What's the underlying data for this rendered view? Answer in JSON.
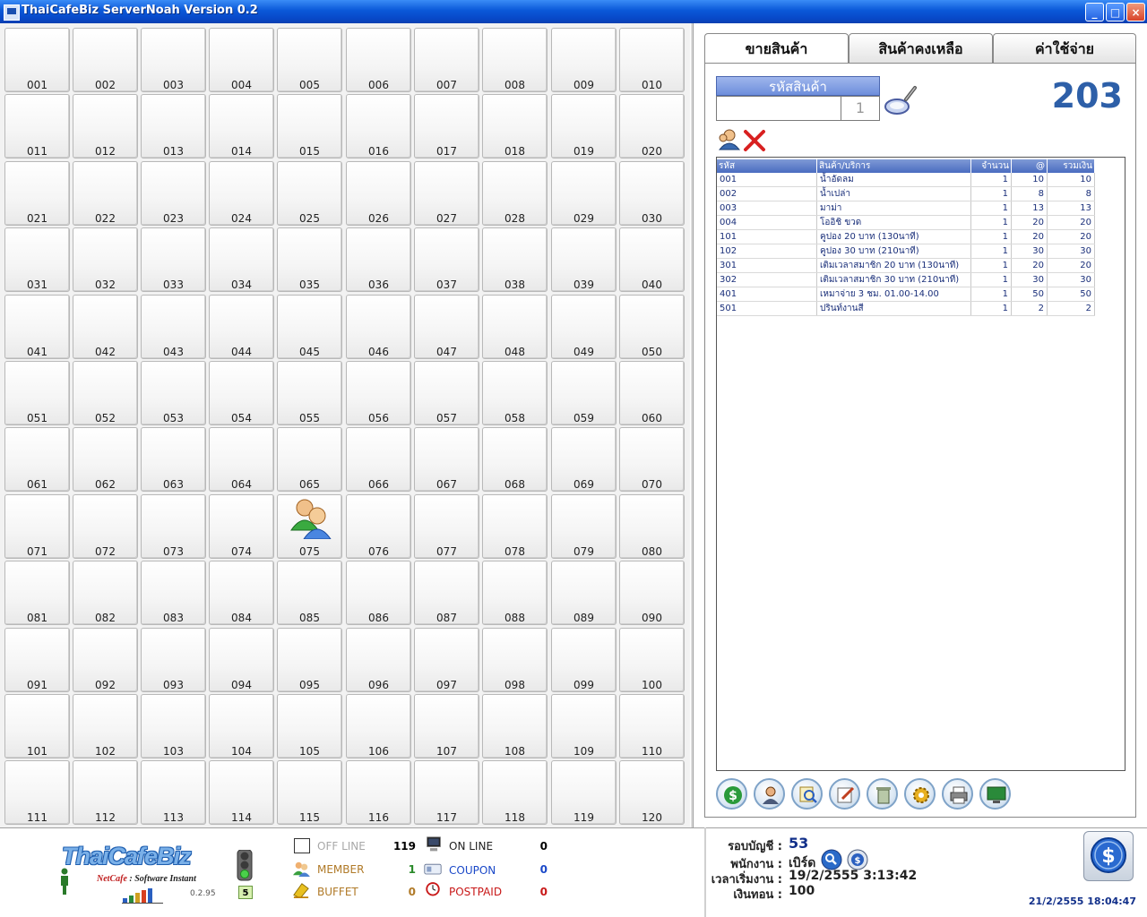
{
  "window": {
    "title": "ThaiCafeBiz ServerNoah Version 0.2",
    "minimize": "_",
    "maximize": "□",
    "close": "×"
  },
  "grid": {
    "occupied_station": "075",
    "stations": [
      "001",
      "002",
      "003",
      "004",
      "005",
      "006",
      "007",
      "008",
      "009",
      "010",
      "011",
      "012",
      "013",
      "014",
      "015",
      "016",
      "017",
      "018",
      "019",
      "020",
      "021",
      "022",
      "023",
      "024",
      "025",
      "026",
      "027",
      "028",
      "029",
      "030",
      "031",
      "032",
      "033",
      "034",
      "035",
      "036",
      "037",
      "038",
      "039",
      "040",
      "041",
      "042",
      "043",
      "044",
      "045",
      "046",
      "047",
      "048",
      "049",
      "050",
      "051",
      "052",
      "053",
      "054",
      "055",
      "056",
      "057",
      "058",
      "059",
      "060",
      "061",
      "062",
      "063",
      "064",
      "065",
      "066",
      "067",
      "068",
      "069",
      "070",
      "071",
      "072",
      "073",
      "074",
      "075",
      "076",
      "077",
      "078",
      "079",
      "080",
      "081",
      "082",
      "083",
      "084",
      "085",
      "086",
      "087",
      "088",
      "089",
      "090",
      "091",
      "092",
      "093",
      "094",
      "095",
      "096",
      "097",
      "098",
      "099",
      "100",
      "101",
      "102",
      "103",
      "104",
      "105",
      "106",
      "107",
      "108",
      "109",
      "110",
      "111",
      "112",
      "113",
      "114",
      "115",
      "116",
      "117",
      "118",
      "119",
      "120"
    ]
  },
  "tabs": [
    {
      "label": "ขายสินค้า",
      "active": true
    },
    {
      "label": "สินค้าคงเหลือ",
      "active": false
    },
    {
      "label": "ค่าใช้จ่าย",
      "active": false
    }
  ],
  "sale": {
    "code_header": "รหัสสินค้า",
    "code_value": "",
    "quantity": "1",
    "station_number": "203"
  },
  "items_table": {
    "headers": {
      "code": "รหัส",
      "name": "สินค้า/บริการ",
      "qty": "จำนวน",
      "price": "@",
      "total": "รวมเงิน"
    },
    "rows": [
      {
        "code": "001",
        "name": "น้ำอัดลม",
        "qty": "1",
        "price": "10",
        "total": "10"
      },
      {
        "code": "002",
        "name": "น้ำเปล่า",
        "qty": "1",
        "price": "8",
        "total": "8"
      },
      {
        "code": "003",
        "name": "มาม่า",
        "qty": "1",
        "price": "13",
        "total": "13"
      },
      {
        "code": "004",
        "name": "โออิชิ ขวด",
        "qty": "1",
        "price": "20",
        "total": "20"
      },
      {
        "code": "101",
        "name": "คูปอง 20 บาท (130นาที)",
        "qty": "1",
        "price": "20",
        "total": "20"
      },
      {
        "code": "102",
        "name": "คูปอง 30 บาท (210นาที)",
        "qty": "1",
        "price": "30",
        "total": "30"
      },
      {
        "code": "301",
        "name": "เติมเวลาสมาชิก 20 บาท (130นาที)",
        "qty": "1",
        "price": "20",
        "total": "20"
      },
      {
        "code": "302",
        "name": "เติมเวลาสมาชิก 30 บาท (210นาที)",
        "qty": "1",
        "price": "30",
        "total": "30"
      },
      {
        "code": "401",
        "name": "เหมาจ่าย 3 ชม. 01.00-14.00",
        "qty": "1",
        "price": "50",
        "total": "50"
      },
      {
        "code": "501",
        "name": "ปรินท์งานสี",
        "qty": "1",
        "price": "2",
        "total": "2"
      }
    ]
  },
  "toolbar_icons": [
    "dollar-icon",
    "member-icon",
    "search-report-icon",
    "edit-icon",
    "trash-icon",
    "settings-icon",
    "printer-icon",
    "monitor-icon"
  ],
  "status": {
    "offline_label": "OFF LINE",
    "offline_count": "119",
    "member_label": "MEMBER",
    "member_count": "1",
    "buffet_label": "BUFFET",
    "buffet_count": "0",
    "online_label": "ON LINE",
    "online_count": "0",
    "coupon_label": "COUPON",
    "coupon_count": "0",
    "postpaid_label": "POSTPAID",
    "postpaid_count": "0",
    "traffic_count": "5"
  },
  "logo": {
    "brand": "ThaiCafeBiz",
    "tagline_a": "NetCafe",
    "tagline_b": " : Software Instant",
    "version": "0.2.95"
  },
  "account": {
    "round_label": "รอบบัญชี :",
    "round_value": "53",
    "staff_label": "พนักงาน :",
    "staff_value": "เบิร์ด",
    "start_label": "เวลาเริ่มงาน :",
    "start_value": "19/2/2555 3:13:42",
    "change_label": "เงินทอน :",
    "change_value": "100"
  },
  "clock": "21/2/2555 18:04:47",
  "colors": {
    "titlebar": "#0a58d8",
    "accent_blue": "#2d5fa8",
    "online": "#1a48c8",
    "postpaid": "#c81818"
  }
}
